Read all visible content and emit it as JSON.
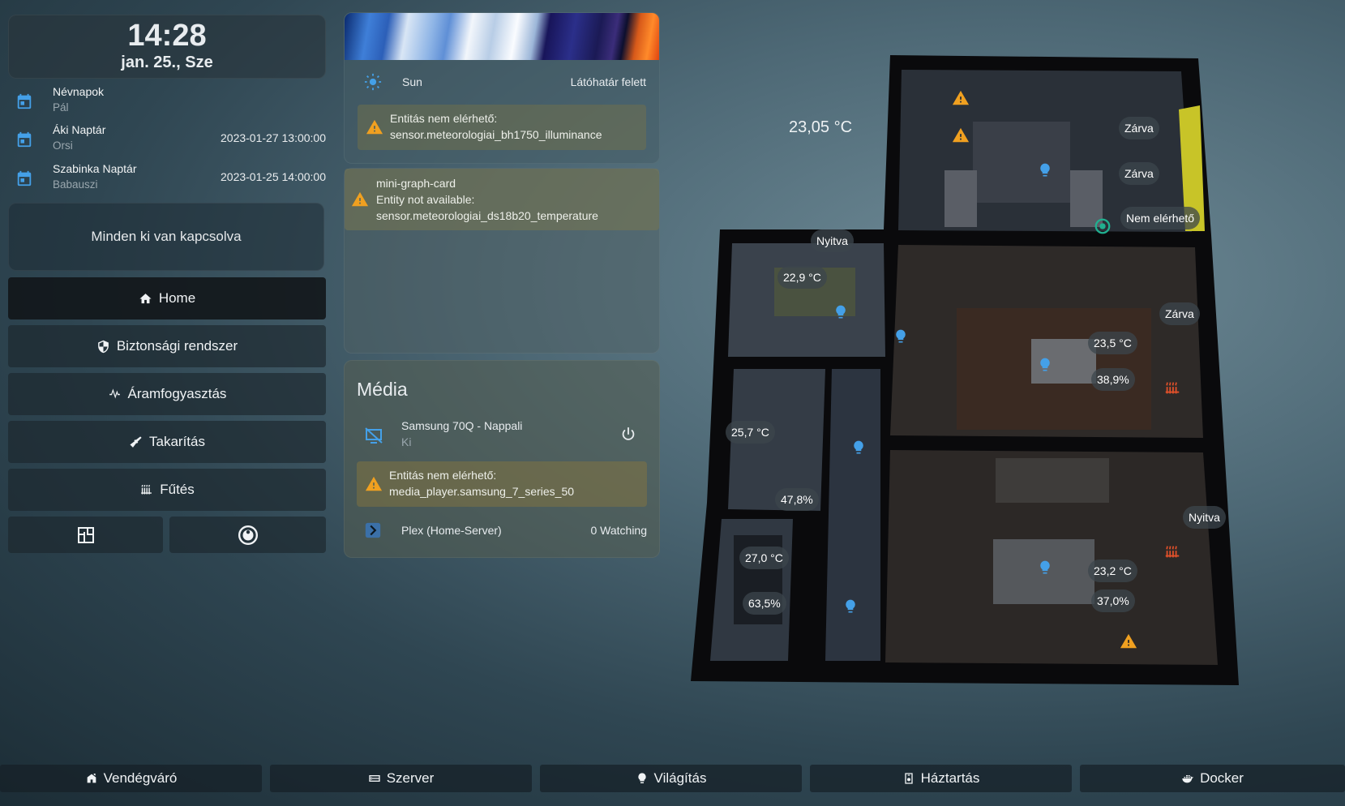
{
  "clock": {
    "time": "14:28",
    "date": "jan. 25., Sze"
  },
  "calendars": [
    {
      "title": "Névnapok",
      "subtitle": "Pál",
      "datetime": ""
    },
    {
      "title": "Áki Naptár",
      "subtitle": "Orsi",
      "datetime": "2023-01-27 13:00:00"
    },
    {
      "title": "Szabinka Naptár",
      "subtitle": "Babauszi",
      "datetime": "2023-01-25 14:00:00"
    }
  ],
  "status_card": {
    "text": "Minden ki van kapcsolva"
  },
  "nav": [
    {
      "label": "Home",
      "icon": "home-icon"
    },
    {
      "label": "Biztonsági rendszer",
      "icon": "shield-icon"
    },
    {
      "label": "Áramfogyasztás",
      "icon": "pulse-icon"
    },
    {
      "label": "Takarítás",
      "icon": "broom-icon"
    },
    {
      "label": "Fűtés",
      "icon": "radiator-icon"
    }
  ],
  "weather": {
    "sun_label": "Sun",
    "sun_state": "Látóhatár felett",
    "warning_line1": "Entitás nem elérhető:",
    "warning_line2": "sensor.meteorologiai_bh1750_illuminance"
  },
  "graph_warning": {
    "line1": "mini-graph-card",
    "line2": "Entity not available:",
    "line3": "sensor.meteorologiai_ds18b20_temperature"
  },
  "media": {
    "title": "Média",
    "tv_name": "Samsung 70Q - Nappali",
    "tv_state": "Ki",
    "warning_line1": "Entitás nem elérhető:",
    "warning_line2": "media_player.samsung_7_series_50",
    "plex_name": "Plex (Home-Server)",
    "plex_state": "0 Watching"
  },
  "floorplan": {
    "outdoor_temp": "23,05 °C",
    "labels": {
      "bedroom_window1": "Zárva",
      "bedroom_window2": "Zárva",
      "bedroom_unavailable": "Nem elérhető",
      "kitchen_door": "Nyitva",
      "kitchen_temp": "22,9 °C",
      "living_window": "Zárva",
      "living_temp": "23,5 °C",
      "living_humidity": "38,9%",
      "bath_temp": "25,7 °C",
      "bath_humidity": "47,8%",
      "wc_temp": "27,0 °C",
      "wc_humidity": "63,5%",
      "kids_window": "Nyitva",
      "kids_temp": "23,2 °C",
      "kids_humidity": "37,0%"
    }
  },
  "bottom_nav": [
    {
      "label": "Vendégváró",
      "icon": "guest-icon"
    },
    {
      "label": "Szerver",
      "icon": "server-icon"
    },
    {
      "label": "Világítás",
      "icon": "bulb-icon"
    },
    {
      "label": "Háztartás",
      "icon": "household-icon"
    },
    {
      "label": "Docker",
      "icon": "docker-icon"
    }
  ],
  "colors": {
    "accent_blue": "#44a0e8",
    "warning": "#f0a020",
    "heater": "#e0502a"
  }
}
